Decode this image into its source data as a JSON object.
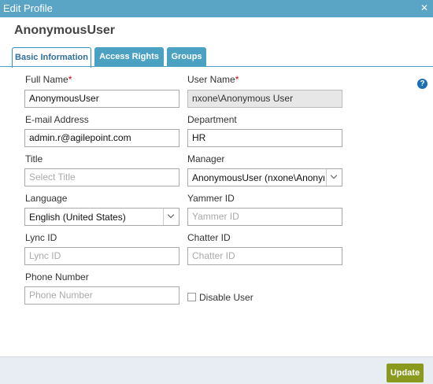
{
  "window": {
    "title": "Edit Profile",
    "close_glyph": "✕"
  },
  "user_display_name": "AnonymousUser",
  "tabs": [
    {
      "label": "Basic Information",
      "active": true
    },
    {
      "label": "Access Rights",
      "active": false
    },
    {
      "label": "Groups",
      "active": false
    }
  ],
  "help_glyph": "?",
  "form": {
    "full_name": {
      "label": "Full Name",
      "required_mark": "*",
      "value": "AnonymousUser"
    },
    "user_name": {
      "label": "User Name",
      "required_mark": "*",
      "value": "nxone\\Anonymous User"
    },
    "email": {
      "label": "E-mail Address",
      "value": "admin.r@agilepoint.com"
    },
    "department": {
      "label": "Department",
      "value": "HR"
    },
    "title": {
      "label": "Title",
      "placeholder": "Select Title"
    },
    "manager": {
      "label": "Manager",
      "value": "AnonymousUser (nxone\\Anonymous User)"
    },
    "language": {
      "label": "Language",
      "value": "English (United States)"
    },
    "yammer_id": {
      "label": "Yammer ID",
      "placeholder": "Yammer ID"
    },
    "lync_id": {
      "label": "Lync ID",
      "placeholder": "Lync ID"
    },
    "chatter_id": {
      "label": "Chatter ID",
      "placeholder": "Chatter ID"
    },
    "phone_number": {
      "label": "Phone Number",
      "placeholder": "Phone Number"
    },
    "disable_user": {
      "label": "Disable User",
      "checked": false
    }
  },
  "footer": {
    "update_label": "Update"
  },
  "colors": {
    "titlebar": "#5aa4c6",
    "tab": "#4aa1c2",
    "update_button": "#8a9a1e",
    "help_icon": "#1a6fb5",
    "required": "#cc0000"
  }
}
